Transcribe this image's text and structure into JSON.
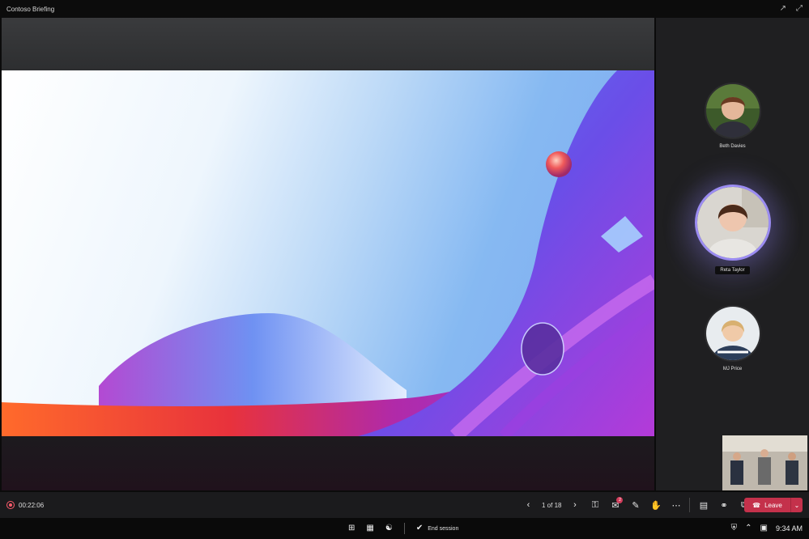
{
  "window": {
    "title": "Contoso Briefing",
    "icons": [
      "pin-icon",
      "expand-icon"
    ]
  },
  "roster": {
    "participants": [
      {
        "name": "Beth Davies",
        "speaking": false
      },
      {
        "name": "Reta Taylor",
        "speaking": true
      },
      {
        "name": "MJ Price",
        "speaking": false
      }
    ]
  },
  "controls": {
    "timer": "00:22:06",
    "pager": "1 of 18",
    "chat_badge": "2",
    "leave_label": "Leave"
  },
  "taskbar": {
    "end_session_label": "End session",
    "clock": "9:34 AM"
  },
  "colors": {
    "accent": "#9b8cf2",
    "leave": "#c4314b",
    "record": "#ff5c6c"
  }
}
